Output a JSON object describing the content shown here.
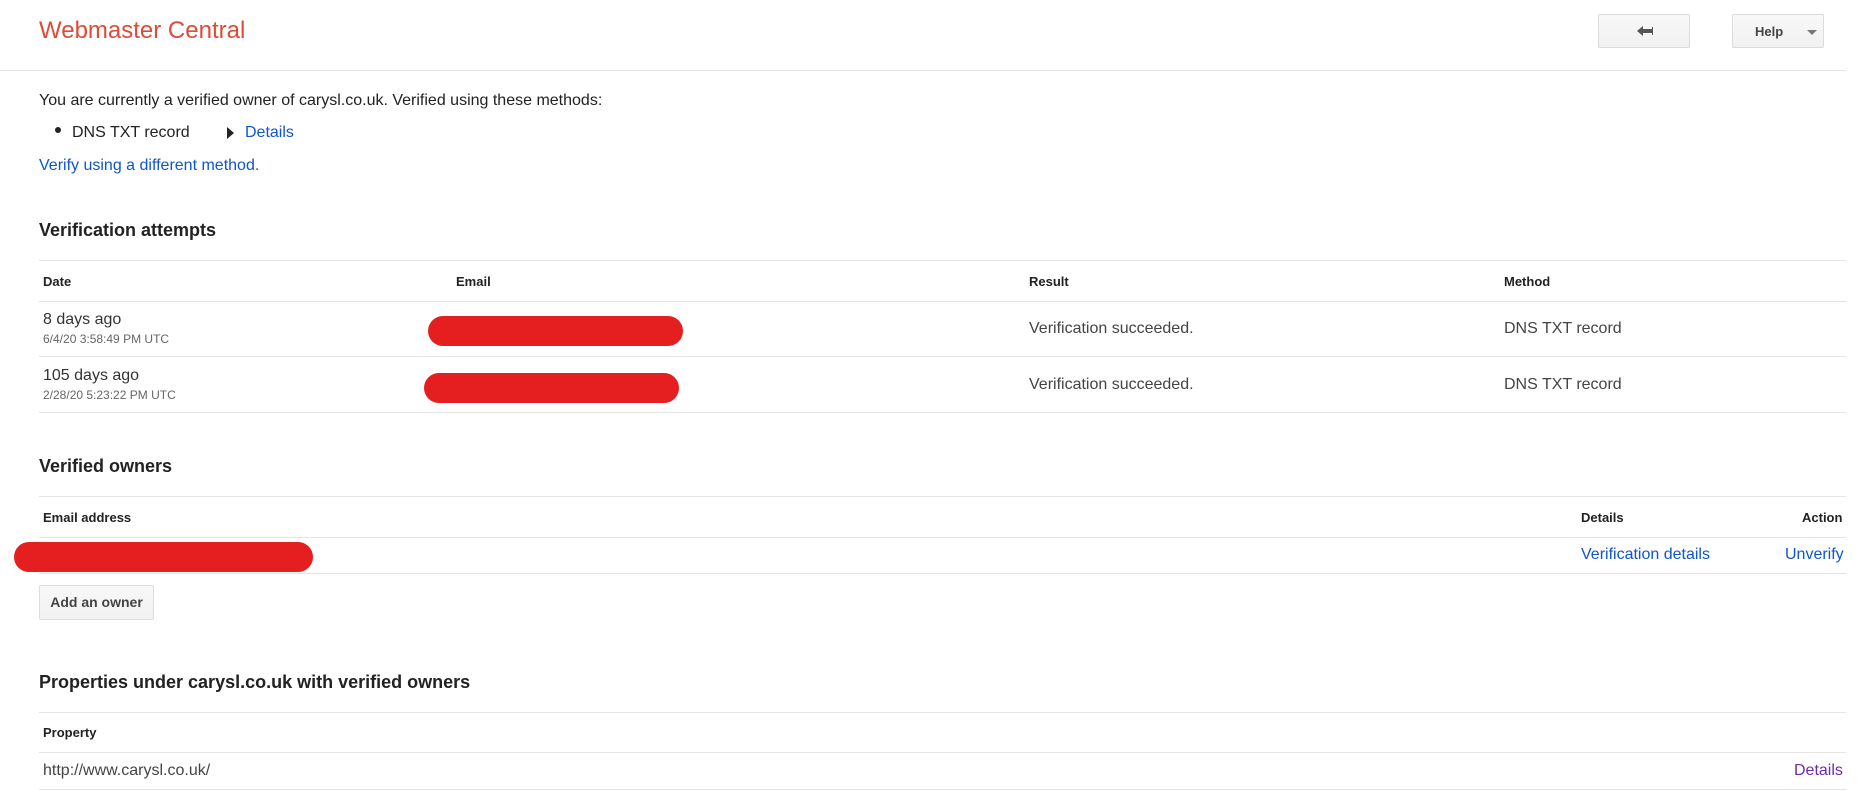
{
  "header": {
    "app_title": "Webmaster Central",
    "back_icon": "back-arrow-icon",
    "help_label": "Help",
    "help_caret_icon": "caret-down-icon"
  },
  "ownership": {
    "intro": "You are currently a verified owner of carysl.co.uk. Verified using these methods:",
    "methods": [
      {
        "name": "DNS TXT record",
        "details_label": "Details"
      }
    ],
    "verify_different_label": "Verify using a different method."
  },
  "attempts": {
    "title": "Verification attempts",
    "headers": {
      "date": "Date",
      "email": "Email",
      "result": "Result",
      "method": "Method"
    },
    "rows": [
      {
        "date_relative": "8 days ago",
        "date_full": "6/4/20 3:58:49 PM UTC",
        "result": "Verification succeeded.",
        "method": "DNS TXT record"
      },
      {
        "date_relative": "105 days ago",
        "date_full": "2/28/20 5:23:22 PM UTC",
        "result": "Verification succeeded.",
        "method": "DNS TXT record"
      }
    ]
  },
  "owners": {
    "title": "Verified owners",
    "headers": {
      "email": "Email address",
      "details": "Details",
      "action": "Action"
    },
    "rows": [
      {
        "details_label": "Verification details",
        "action_label": "Unverify"
      }
    ],
    "add_owner_label": "Add an owner"
  },
  "properties": {
    "title": "Properties under carysl.co.uk with verified owners",
    "headers": {
      "property": "Property"
    },
    "rows": [
      {
        "url": "http://www.carysl.co.uk/",
        "details_label": "Details"
      }
    ]
  },
  "colors": {
    "brand": "#dd4b39",
    "link": "#1155cc",
    "visited_link": "#6a2ca8",
    "redaction": "#e51f1f"
  }
}
